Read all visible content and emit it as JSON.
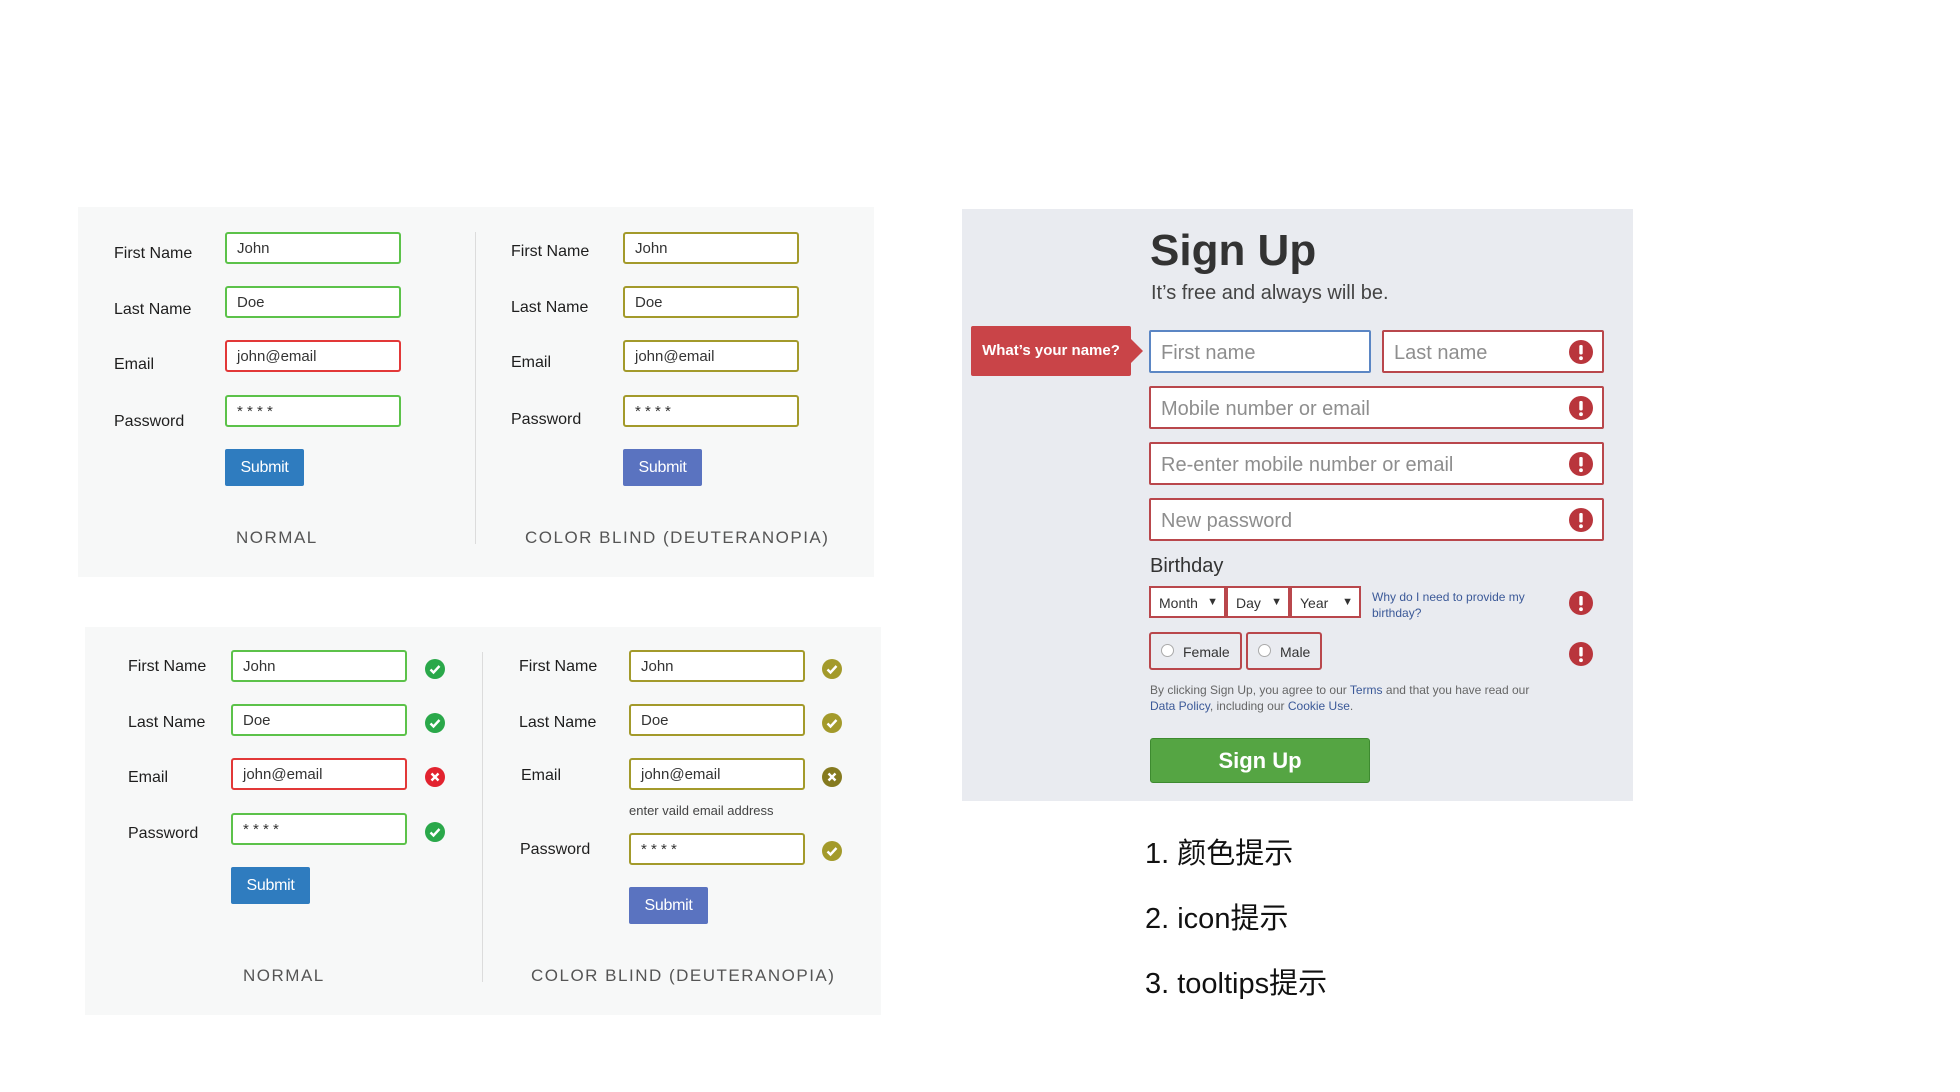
{
  "form_labels": {
    "first_name": "First Name",
    "last_name": "Last Name",
    "email": "Email",
    "password": "Password"
  },
  "form_values": {
    "first_name": "John",
    "last_name": "Doe",
    "email": "john@email",
    "password": "* * * *"
  },
  "submit_label": "Submit",
  "caption_normal": "NORMAL",
  "caption_colorblind": "COLOR BLIND (DEUTERANOPIA)",
  "email_hint": "enter vaild email address",
  "colors": {
    "valid": "#5cc24a",
    "error": "#e23838",
    "colorblind_border": "#a39a2b",
    "submit_normal": "#2f7cbf",
    "submit_colorblind": "#5a73c0",
    "signup_button": "#55a543",
    "fb_error": "#b9474c"
  },
  "signup": {
    "title": "Sign Up",
    "subtitle": "It’s free and always will be.",
    "tooltip": "What’s your name?",
    "first_name_placeholder": "First name",
    "last_name_placeholder": "Last name",
    "mobile_placeholder": "Mobile number or email",
    "reenter_placeholder": "Re-enter mobile number or email",
    "password_placeholder": "New password",
    "birthday_label": "Birthday",
    "month": "Month",
    "day": "Day",
    "year": "Year",
    "why_birthday": "Why do I need to provide my birthday?",
    "female": "Female",
    "male": "Male",
    "legal_pre": "By clicking Sign Up, you agree to our ",
    "terms": "Terms",
    "legal_mid": " and that you have read our ",
    "data_policy": "Data Policy",
    "legal_mid2": ", including our ",
    "cookie_use": "Cookie Use",
    "legal_end": ".",
    "button": "Sign Up"
  },
  "notes": [
    "1. 颜色提示",
    "2. icon提示",
    "3. tooltips提示"
  ]
}
